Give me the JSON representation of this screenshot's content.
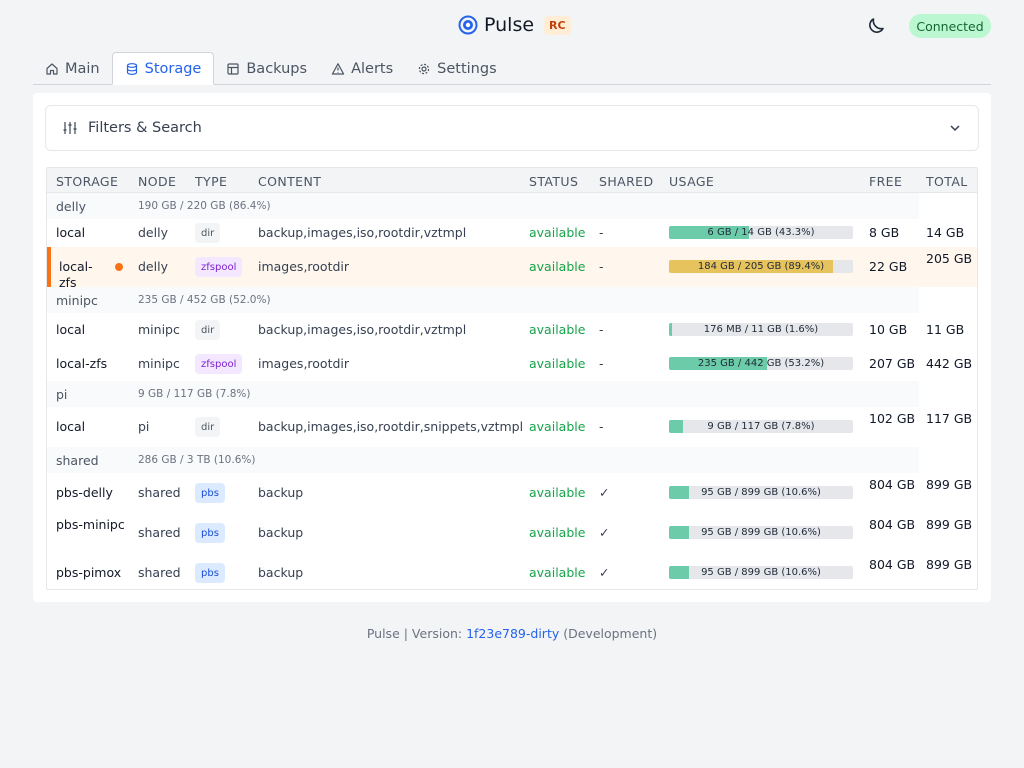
{
  "header": {
    "app_name": "Pulse",
    "badge": "RC",
    "connection_status": "Connected"
  },
  "tabs": [
    {
      "label": "Main",
      "icon": "home-icon"
    },
    {
      "label": "Storage",
      "icon": "database-icon",
      "active": true
    },
    {
      "label": "Backups",
      "icon": "table-icon"
    },
    {
      "label": "Alerts",
      "icon": "warning-icon"
    },
    {
      "label": "Settings",
      "icon": "gear-icon"
    }
  ],
  "filters": {
    "label": "Filters & Search"
  },
  "table": {
    "columns": [
      "STORAGE",
      "NODE",
      "TYPE",
      "CONTENT",
      "STATUS",
      "SHARED",
      "USAGE",
      "FREE",
      "TOTAL"
    ],
    "groups": [
      {
        "name": "delly",
        "summary": "190 GB / 220 GB (86.4%)",
        "rows": [
          {
            "storage": "local",
            "node": "delly",
            "type": "dir",
            "content": "backup,images,iso,rootdir,vztmpl",
            "status": "available",
            "shared": "-",
            "usage_text": "6 GB / 14 GB (43.3%)",
            "usage_pct": 43.3,
            "free": "8 GB",
            "total": "14 GB",
            "alert": false
          },
          {
            "storage": "local-zfs",
            "node": "delly",
            "type": "zfspool",
            "content": "images,rootdir",
            "status": "available",
            "shared": "-",
            "usage_text": "184 GB / 205 GB (89.4%)",
            "usage_pct": 89.4,
            "free": "22 GB",
            "total": "205 GB",
            "alert": true
          }
        ]
      },
      {
        "name": "minipc",
        "summary": "235 GB / 452 GB (52.0%)",
        "rows": [
          {
            "storage": "local",
            "node": "minipc",
            "type": "dir",
            "content": "backup,images,iso,rootdir,vztmpl",
            "status": "available",
            "shared": "-",
            "usage_text": "176 MB / 11 GB (1.6%)",
            "usage_pct": 1.6,
            "free": "10 GB",
            "total": "11 GB",
            "alert": false
          },
          {
            "storage": "local-zfs",
            "node": "minipc",
            "type": "zfspool",
            "content": "images,rootdir",
            "status": "available",
            "shared": "-",
            "usage_text": "235 GB / 442 GB (53.2%)",
            "usage_pct": 53.2,
            "free": "207 GB",
            "total": "442 GB",
            "alert": false
          }
        ]
      },
      {
        "name": "pi",
        "summary": "9 GB / 117 GB (7.8%)",
        "rows": [
          {
            "storage": "local",
            "node": "pi",
            "type": "dir",
            "content": "backup,images,iso,rootdir,snippets,vztmpl",
            "status": "available",
            "shared": "-",
            "usage_text": "9 GB / 117 GB (7.8%)",
            "usage_pct": 7.8,
            "free": "102 GB",
            "total": "117 GB",
            "alert": false
          }
        ]
      },
      {
        "name": "shared",
        "summary": "286 GB / 3 TB (10.6%)",
        "rows": [
          {
            "storage": "pbs-delly",
            "node": "shared",
            "type": "pbs",
            "content": "backup",
            "status": "available",
            "shared": "✓",
            "usage_text": "95 GB / 899 GB (10.6%)",
            "usage_pct": 10.6,
            "free": "804 GB",
            "total": "899 GB",
            "alert": false
          },
          {
            "storage": "pbs-minipc",
            "node": "shared",
            "type": "pbs",
            "content": "backup",
            "status": "available",
            "shared": "✓",
            "usage_text": "95 GB / 899 GB (10.6%)",
            "usage_pct": 10.6,
            "free": "804 GB",
            "total": "899 GB",
            "alert": false
          },
          {
            "storage": "pbs-pimox",
            "node": "shared",
            "type": "pbs",
            "content": "backup",
            "status": "available",
            "shared": "✓",
            "usage_text": "95 GB / 899 GB (10.6%)",
            "usage_pct": 10.6,
            "free": "804 GB",
            "total": "899 GB",
            "alert": false
          }
        ]
      }
    ]
  },
  "footer": {
    "prefix": "Pulse | Version: ",
    "version": "1f23e789-dirty",
    "suffix": " (Development)"
  },
  "colors": {
    "usage_green": "#6ccba8",
    "usage_yellow": "#e6c35c",
    "accent": "#2563eb",
    "alert_orange": "#f97316"
  }
}
